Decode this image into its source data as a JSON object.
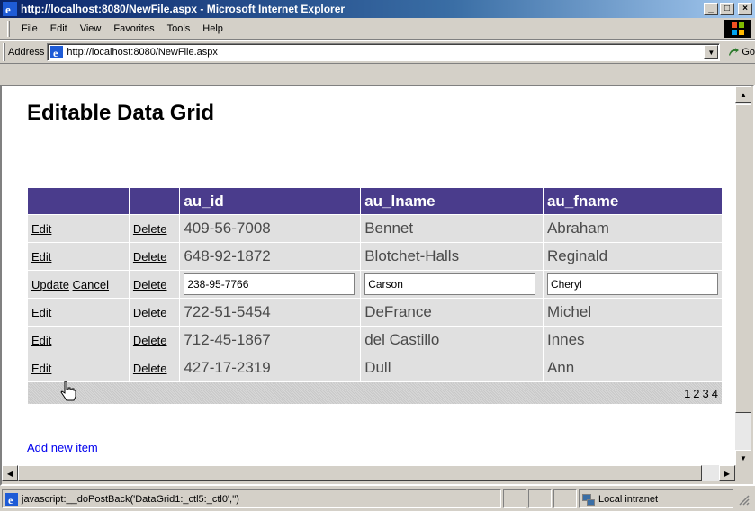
{
  "window": {
    "title": "http://localhost:8080/NewFile.aspx - Microsoft Internet Explorer",
    "minimize": "_",
    "maximize": "□",
    "close": "×"
  },
  "menu": [
    "File",
    "Edit",
    "View",
    "Favorites",
    "Tools",
    "Help"
  ],
  "address": {
    "label": "Address",
    "url": "http://localhost:8080/NewFile.aspx",
    "go_label": "Go"
  },
  "page": {
    "title": "Editable Data Grid",
    "add_link": "Add new item"
  },
  "grid": {
    "headers": [
      "",
      "",
      "au_id",
      "au_lname",
      "au_fname"
    ],
    "rows": [
      {
        "edit": "Edit",
        "delete": "Delete",
        "au_id": "409-56-7008",
        "au_lname": "Bennet",
        "au_fname": "Abraham"
      },
      {
        "edit": "Edit",
        "delete": "Delete",
        "au_id": "648-92-1872",
        "au_lname": "Blotchet-Halls",
        "au_fname": "Reginald"
      },
      {
        "update": "Update",
        "cancel": "Cancel",
        "delete": "Delete",
        "au_id": "238-95-7766",
        "au_lname": "Carson",
        "au_fname": "Cheryl",
        "editing": true
      },
      {
        "edit": "Edit",
        "delete": "Delete",
        "au_id": "722-51-5454",
        "au_lname": "DeFrance",
        "au_fname": "Michel"
      },
      {
        "edit": "Edit",
        "delete": "Delete",
        "au_id": "712-45-1867",
        "au_lname": "del Castillo",
        "au_fname": "Innes"
      },
      {
        "edit": "Edit",
        "delete": "Delete",
        "au_id": "427-17-2319",
        "au_lname": "Dull",
        "au_fname": "Ann"
      }
    ],
    "pager": [
      "1",
      "2",
      "3",
      "4"
    ],
    "current_page": "1"
  },
  "status": {
    "text": "javascript:__doPostBack('DataGrid1:_ctl5:_ctl0','')",
    "zone": "Local intranet"
  },
  "colors": {
    "header_bg": "#4a3c8c",
    "row_bg": "#e0e0e0",
    "titlebar": "#0a246a",
    "link": "#0000ee"
  }
}
